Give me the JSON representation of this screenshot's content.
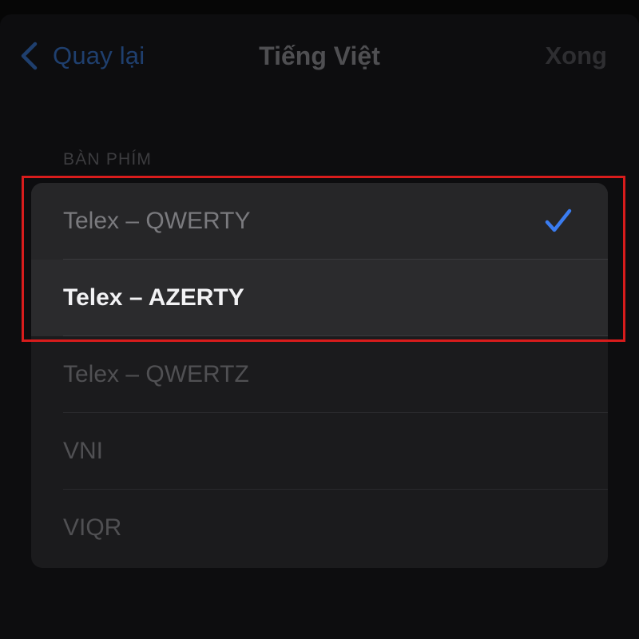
{
  "nav": {
    "back_label": "Quay lại",
    "title": "Tiếng Việt",
    "done_label": "Xong"
  },
  "section": {
    "header": "BÀN PHÍM"
  },
  "keyboards": [
    {
      "label": "Telex – QWERTY",
      "selected": true
    },
    {
      "label": "Telex – AZERTY",
      "selected": false
    },
    {
      "label": "Telex – QWERTZ",
      "selected": false
    },
    {
      "label": "VNI",
      "selected": false
    },
    {
      "label": "VIQR",
      "selected": false
    }
  ],
  "colors": {
    "accent": "#3a7cf0",
    "annotation_box": "#d81c1c",
    "background": "#0d0d0f",
    "group_background": "#1b1b1d"
  },
  "icons": {
    "back": "chevron-left-icon",
    "selected": "checkmark-icon"
  }
}
